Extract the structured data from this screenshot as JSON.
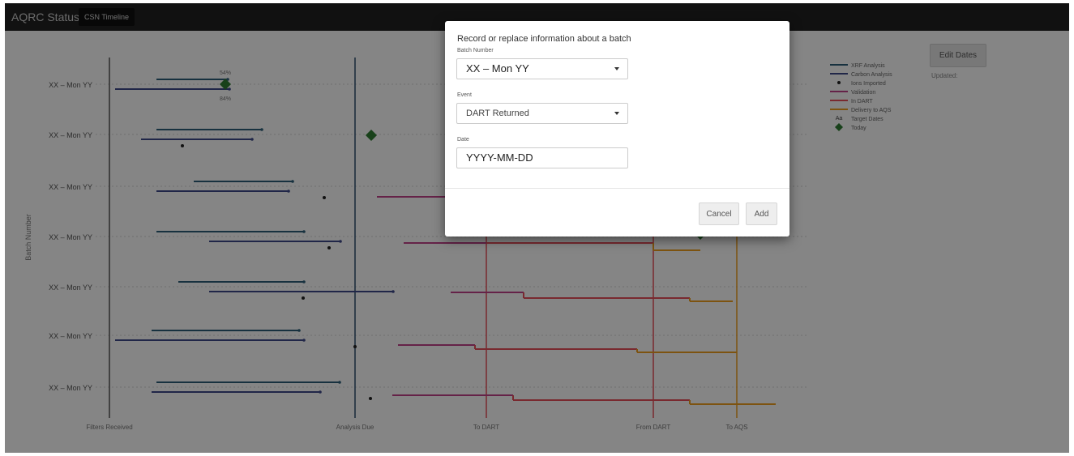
{
  "app": {
    "title": "AQRC Status",
    "tab_label": "CSN Timeline",
    "edit_dates_label": "Edit Dates",
    "updated_label": "Updated:"
  },
  "chart_data": {
    "type": "timeline",
    "ylabel": "Batch Number",
    "milestones": [
      "Filters Received",
      "Analysis Due",
      "To DART",
      "From DART",
      "To AQS"
    ],
    "rows": [
      "XX – Mon YY",
      "XX – Mon YY",
      "XX – Mon YY",
      "XX – Mon YY",
      "XX – Mon YY",
      "XX – Mon YY",
      "XX – Mon YY"
    ],
    "first_row_annotations": [
      "54%",
      "84%"
    ],
    "legend": [
      {
        "label": "XRF Analysis",
        "color": "#2c5f7a",
        "marker": "line"
      },
      {
        "label": "Carbon Analysis",
        "color": "#3f4a8a",
        "marker": "line"
      },
      {
        "label": "Ions Imported",
        "color": "#222222",
        "marker": "dot"
      },
      {
        "label": "Validation",
        "color": "#c2418a",
        "marker": "line"
      },
      {
        "label": "In DART",
        "color": "#e8505b",
        "marker": "line"
      },
      {
        "label": "Delivery to AQS",
        "color": "#f0a020",
        "marker": "line"
      },
      {
        "label": "Target Dates",
        "color": "#444444",
        "marker": "text"
      },
      {
        "label": "Today",
        "color": "#2e7d32",
        "marker": "diamond"
      }
    ]
  },
  "modal": {
    "title": "Record or replace information about a batch",
    "batch_label": "Batch Number",
    "batch_value": "XX – Mon YY",
    "event_label": "Event",
    "event_value": "DART Returned",
    "date_label": "Date",
    "date_value": "YYYY-MM-DD",
    "cancel_label": "Cancel",
    "add_label": "Add"
  }
}
